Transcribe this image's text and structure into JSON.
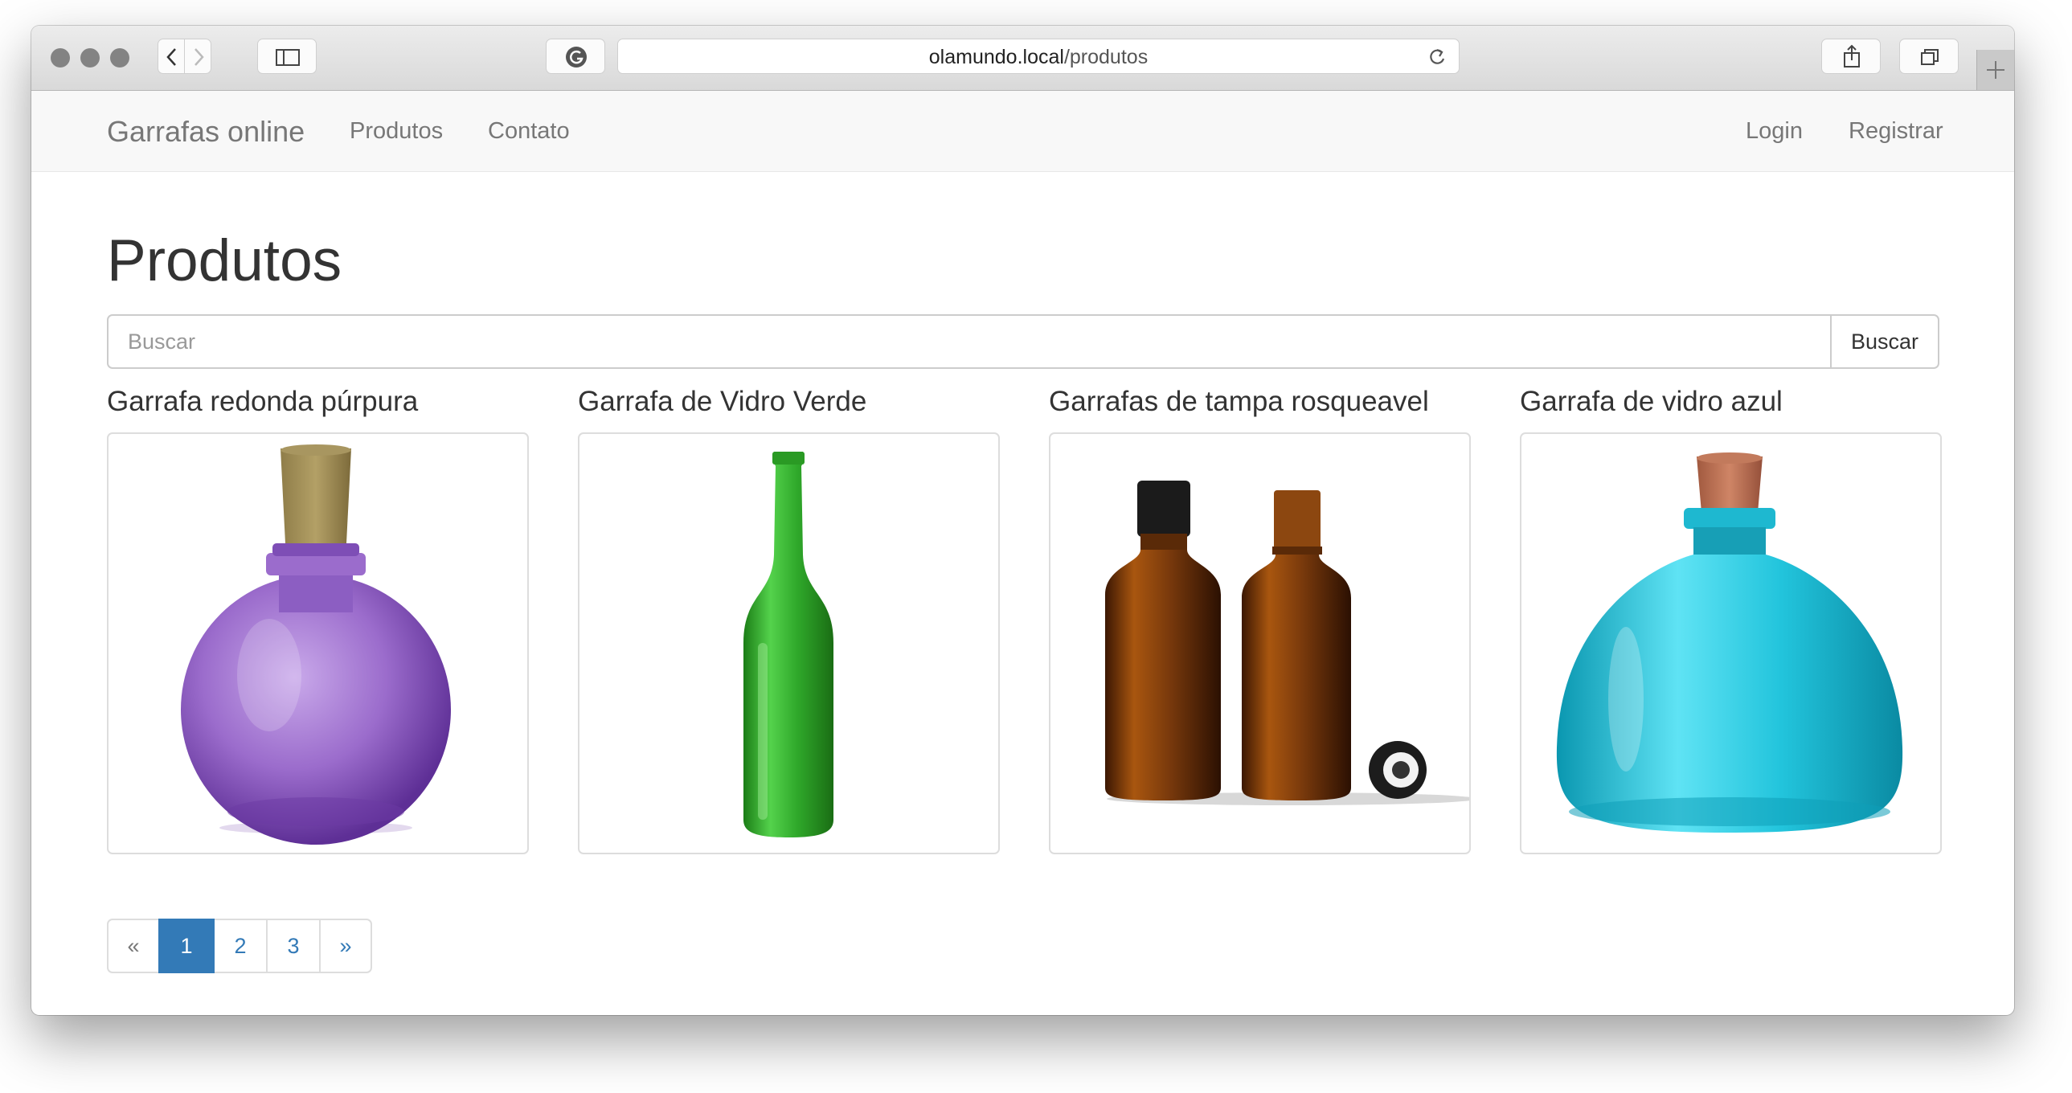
{
  "browser": {
    "url_host": "olamundo.local",
    "url_path": "/produtos"
  },
  "navbar": {
    "brand": "Garrafas online",
    "links": [
      "Produtos",
      "Contato"
    ],
    "right_links": [
      "Login",
      "Registrar"
    ]
  },
  "page": {
    "title": "Produtos",
    "search_placeholder": "Buscar",
    "search_button": "Buscar"
  },
  "products": [
    {
      "title": "Garrafa redonda púrpura",
      "image": "purple-round-bottle",
      "color": "#9b6ccc"
    },
    {
      "title": "Garrafa de Vidro Verde",
      "image": "green-wine-bottle",
      "color": "#2fa82a"
    },
    {
      "title": "Garrafas de tampa rosqueavel",
      "image": "amber-screwcap-bottles",
      "color": "#7a3a0c"
    },
    {
      "title": "Garrafa de vidro azul",
      "image": "turquoise-glass-bottle",
      "color": "#22c4dc"
    }
  ],
  "pagination": {
    "prev": "«",
    "pages": [
      "1",
      "2",
      "3"
    ],
    "next": "»",
    "active": "1"
  },
  "colors": {
    "link": "#337ab7",
    "navbar_bg": "#f8f8f8",
    "navbar_text": "#777777"
  }
}
